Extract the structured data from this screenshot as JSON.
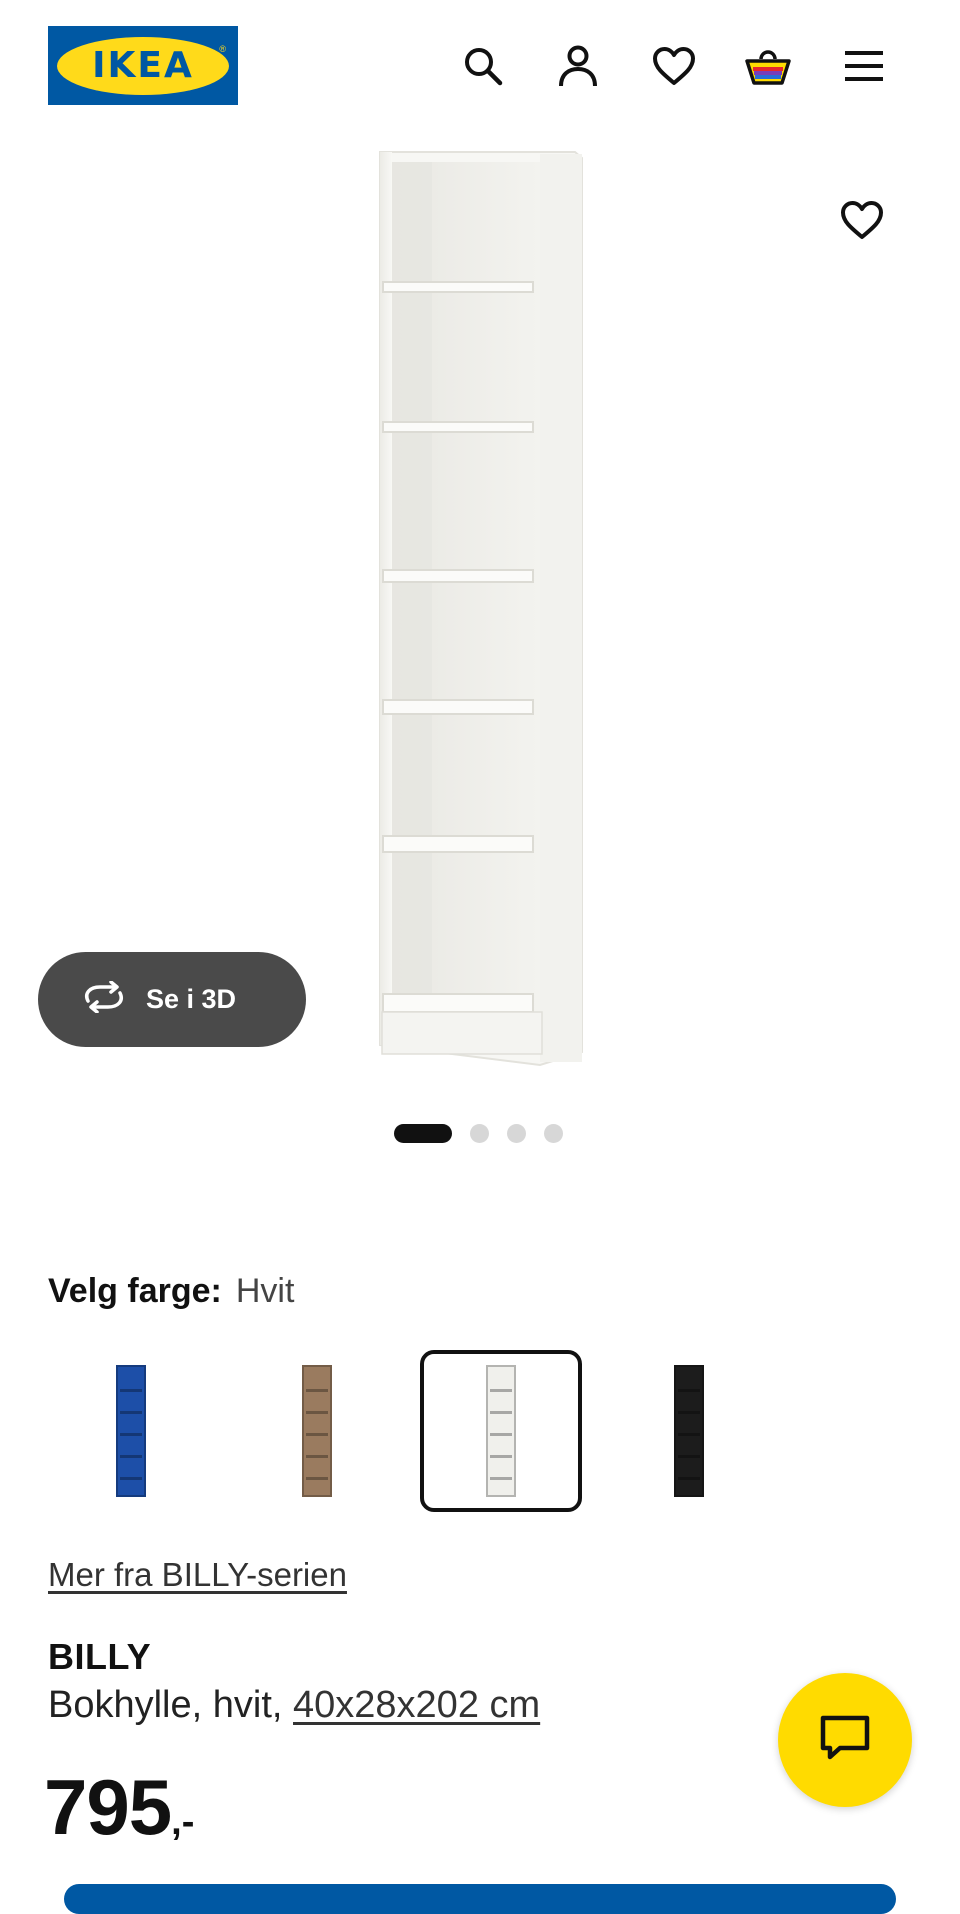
{
  "header": {
    "logo_text": "IKEA",
    "logo_registered": "®",
    "icons": [
      "search-icon",
      "user-icon",
      "heart-icon",
      "basket-icon",
      "menu-icon"
    ]
  },
  "gallery": {
    "view_3d_label": "Se i 3D",
    "slide_count": 4,
    "active_slide": 1
  },
  "color_picker": {
    "label": "Velg farge:",
    "selected": "Hvit",
    "options": [
      {
        "color": "#1d4fa8"
      },
      {
        "color": "#9a7b5f"
      },
      {
        "color": "#f0f0ec"
      },
      {
        "color": "#1c1c1c"
      }
    ]
  },
  "product": {
    "series_link": "Mer fra BILLY-serien",
    "name": "BILLY",
    "description": "Bokhylle, hvit,",
    "dimensions": "40x28x202 cm",
    "price": "795",
    "price_suffix": ",-"
  },
  "colors": {
    "brand_blue": "#0058a3",
    "brand_yellow": "#ffdb00"
  }
}
